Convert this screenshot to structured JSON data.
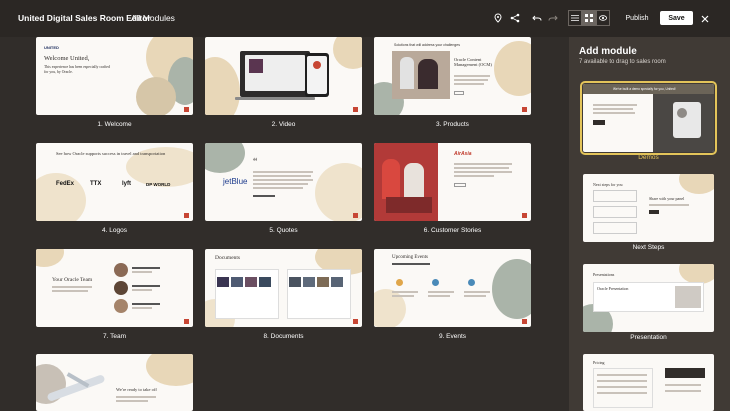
{
  "header": {
    "title": "United Digital Sales Room Editor",
    "subtitle": "All Modules",
    "publish_label": "Publish",
    "save_label": "Save"
  },
  "icons": [
    "pin-icon",
    "share-icon",
    "undo-icon",
    "redo-icon",
    "list-view-icon",
    "grid-view-icon",
    "preview-icon",
    "close-icon"
  ],
  "colors": {
    "background": "#312d2a",
    "topbar": "#2b2724",
    "panel": "#403a35",
    "accent": "#e3c45a",
    "brand_red": "#c74634"
  },
  "modules": [
    {
      "label": "1. Welcome"
    },
    {
      "label": "2. Video"
    },
    {
      "label": "3. Products"
    },
    {
      "label": "4. Logos"
    },
    {
      "label": "5. Quotes"
    },
    {
      "label": "6. Customer Stories"
    },
    {
      "label": "7. Team"
    },
    {
      "label": "8. Documents"
    },
    {
      "label": "9. Events"
    },
    {
      "label": ""
    }
  ],
  "slides": {
    "welcome": {
      "brand": "UNITED",
      "heading": "Welcome United,",
      "body": "This experience has been especially crafted for you, by Oracle."
    },
    "products": {
      "top": "Solutions that will address your challenges",
      "heading": "Oracle Content Management (OCM)"
    },
    "logos": {
      "heading": "See how Oracle supports success in travel and transportation",
      "items": [
        "FedEx",
        "TTX",
        "lyft",
        "DP WORLD"
      ]
    },
    "quotes": {
      "brand": "jetBlue"
    },
    "stories": {
      "brand": "AirAsia"
    },
    "team": {
      "heading": "Your Oracle Team"
    },
    "documents": {
      "heading": "Documents"
    },
    "events": {
      "heading": "Upcoming Events"
    },
    "takeoff": {
      "heading": "We're ready to take off"
    }
  },
  "sidebar": {
    "title": "Add module",
    "subtitle": "7 available to drag to sales room",
    "items": [
      {
        "label": "Demos"
      },
      {
        "label": "Next Steps"
      },
      {
        "label": "Presentation"
      },
      {
        "label": ""
      }
    ],
    "demos_banner": "We've built a demo specially for you, United!",
    "next_steps": {
      "heading": "Next steps for you",
      "share": "Share with your panel"
    },
    "presentation": {
      "heading": "Presentations",
      "item": "Oracle Presentation"
    },
    "pricing": {
      "heading": "Pricing"
    }
  }
}
